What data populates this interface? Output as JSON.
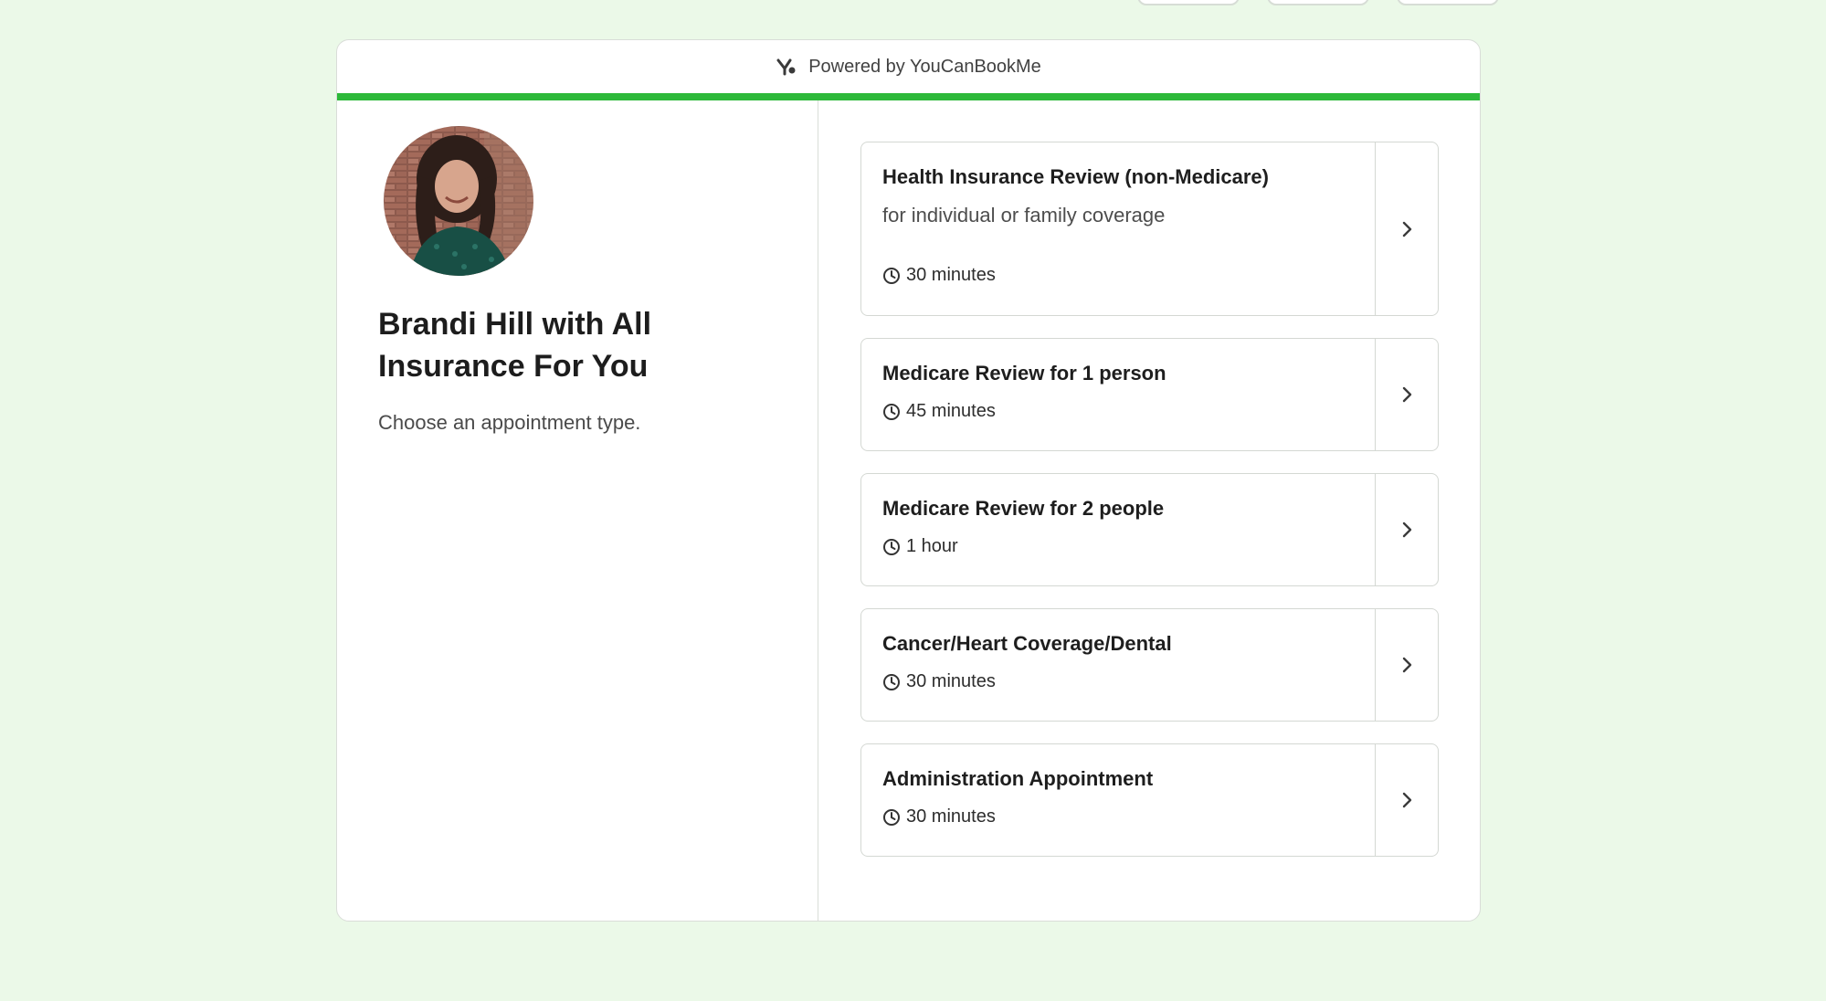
{
  "header": {
    "powered_by": "Powered by YouCanBookMe"
  },
  "profile": {
    "title": "Brandi Hill with All Insurance For You",
    "subtitle": "Choose an appointment type."
  },
  "appointments": [
    {
      "title": "Health Insurance Review (non-Medicare)",
      "description": "for individual or family coverage",
      "duration": "30 minutes"
    },
    {
      "title": "Medicare Review for 1 person",
      "duration": "45 minutes"
    },
    {
      "title": "Medicare Review for 2 people",
      "duration": "1 hour"
    },
    {
      "title": "Cancer/Heart Coverage/Dental",
      "duration": "30 minutes"
    },
    {
      "title": "Administration Appointment",
      "duration": "30 minutes"
    }
  ],
  "colors": {
    "background": "#ebf9e8",
    "accent": "#2db93a",
    "card": "#ffffff",
    "border": "#d9ddd8"
  }
}
